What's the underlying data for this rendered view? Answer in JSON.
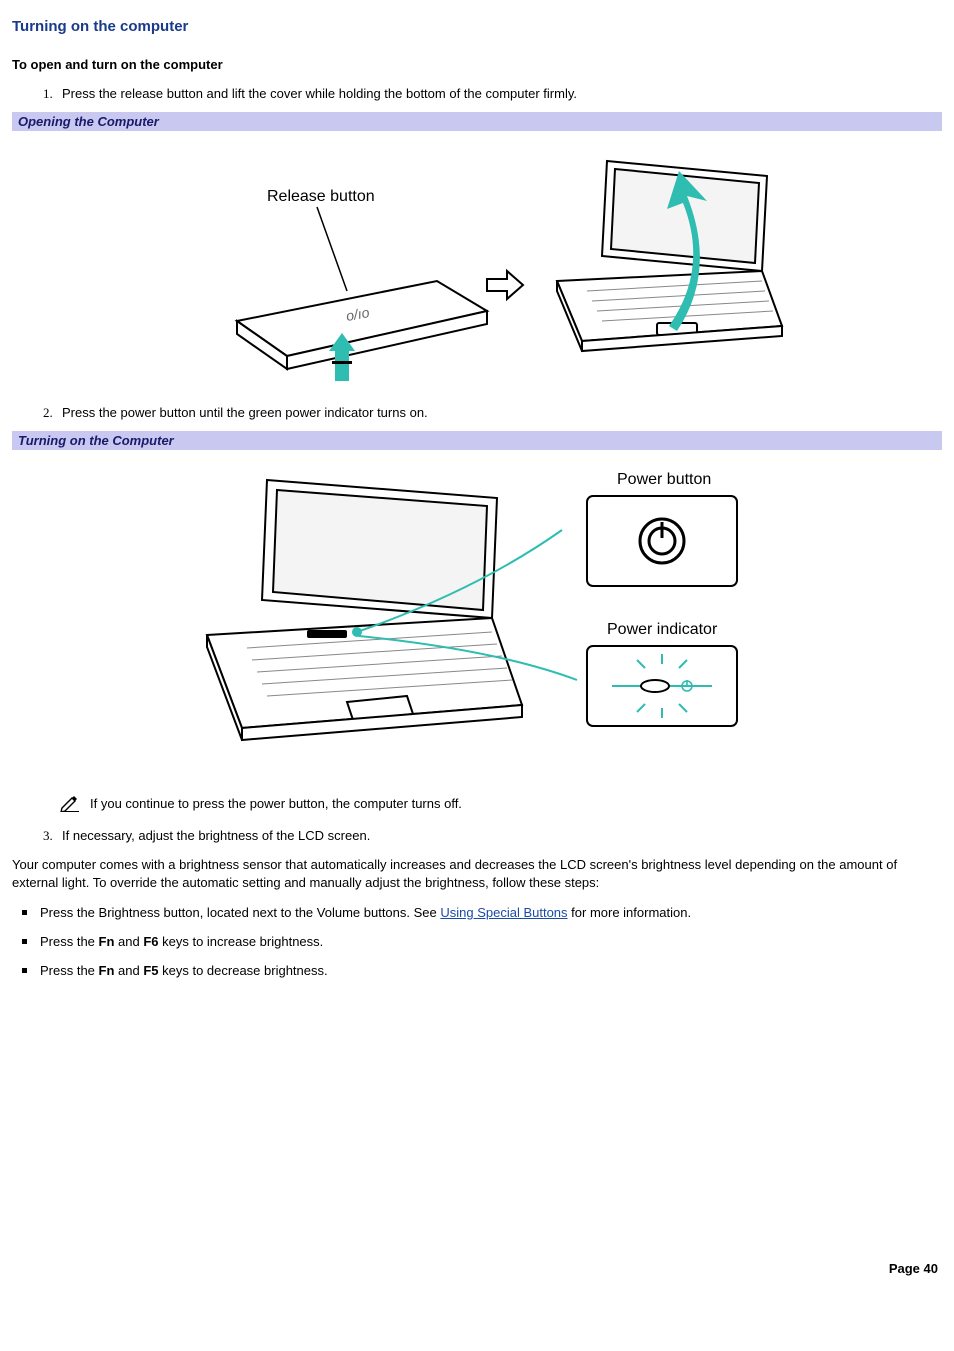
{
  "title": "Turning on the computer",
  "sub_heading": "To open and turn on the computer",
  "steps": {
    "s1": "Press the release button and lift the cover while holding the bottom of the computer firmly.",
    "s2": "Press the power button until the green power indicator turns on.",
    "s3": "If necessary, adjust the brightness of the LCD screen."
  },
  "captions": {
    "opening": "Opening the Computer",
    "turning_on": "Turning on the Computer"
  },
  "figure_labels": {
    "release_button": "Release button",
    "power_button": "Power button",
    "power_indicator": "Power indicator"
  },
  "note_text": "If you continue to press the power button, the computer turns off.",
  "brightness_intro": "Your computer comes with a brightness sensor that automatically increases and decreases the LCD screen's brightness level depending on the amount of external light. To override the automatic setting and manually adjust the brightness, follow these steps:",
  "bullets": {
    "b1_pre": "Press the Brightness button, located next to the Volume buttons. See ",
    "b1_link": "Using Special Buttons",
    "b1_post": " for more information.",
    "b2_pre": "Press the ",
    "b2_k1": "Fn",
    "b2_mid": " and ",
    "b2_k2": "F6",
    "b2_post": " keys to increase brightness.",
    "b3_pre": "Press the ",
    "b3_k1": "Fn",
    "b3_mid": " and ",
    "b3_k2": "F5",
    "b3_post": " keys to decrease brightness."
  },
  "footer": "Page 40"
}
